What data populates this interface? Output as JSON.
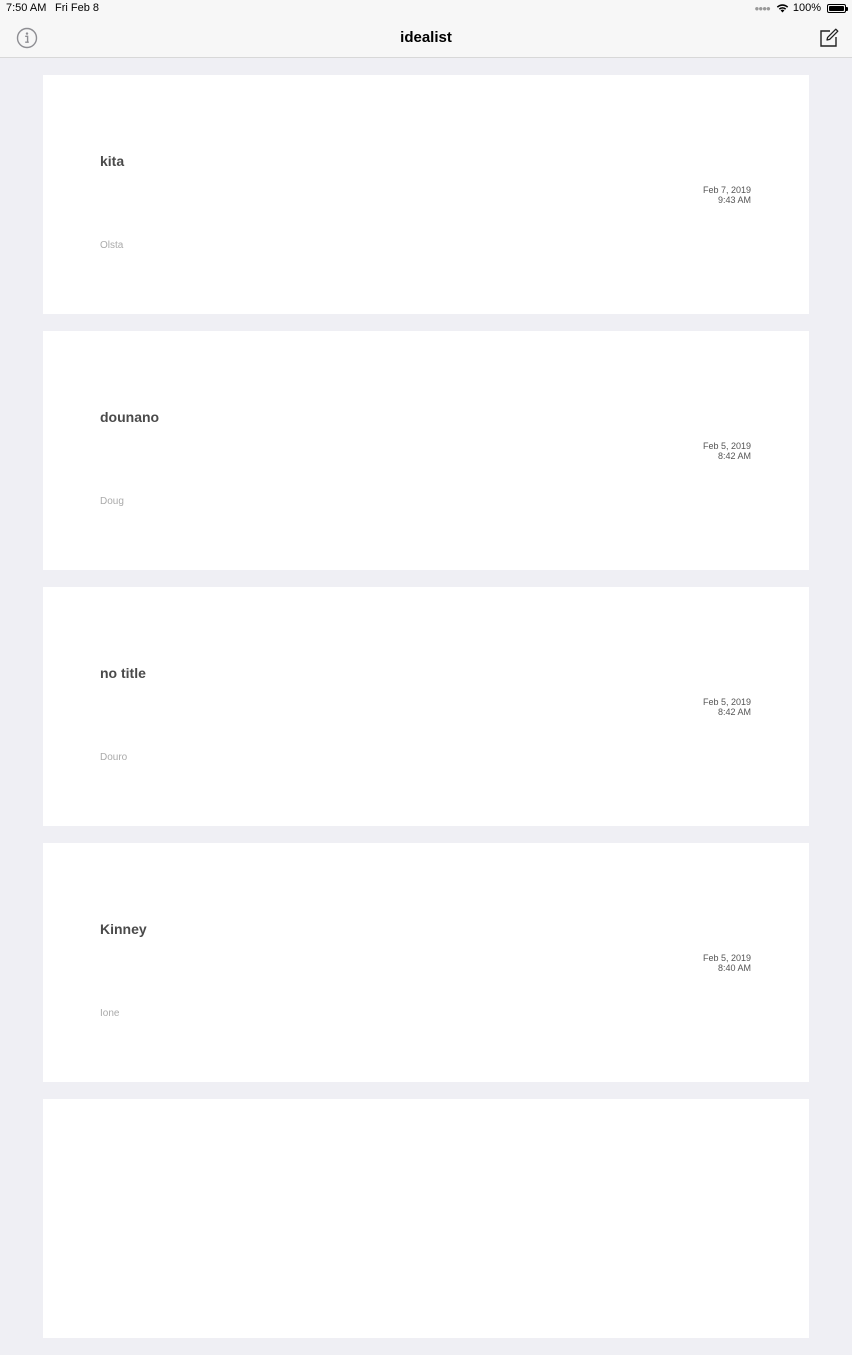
{
  "status_bar": {
    "time": "7:50 AM",
    "date": "Fri Feb 8",
    "battery": "100%",
    "battery_level": 1.0
  },
  "nav": {
    "title": "idealist",
    "left_icon": "info-icon",
    "right_icon": "compose-icon"
  },
  "ideas": [
    {
      "title": "kita",
      "date": "Feb 7, 2019",
      "time": "9:43 AM",
      "subtitle": "Olsta"
    },
    {
      "title": "dounano",
      "date": "Feb 5, 2019",
      "time": "8:42 AM",
      "subtitle": "Doug"
    },
    {
      "title": "no title",
      "date": "Feb 5, 2019",
      "time": "8:42 AM",
      "subtitle": "Douro"
    },
    {
      "title": "Kinney",
      "date": "Feb 5, 2019",
      "time": "8:40 AM",
      "subtitle": "Ione"
    },
    {
      "title": "",
      "date": "",
      "time": "",
      "subtitle": ""
    }
  ],
  "colors": {
    "background": "#efeff4",
    "card": "#ffffff",
    "title_text": "#4a4a4a",
    "subtitle_text": "#aaaaaa",
    "icon_gray": "#8e8e93"
  }
}
